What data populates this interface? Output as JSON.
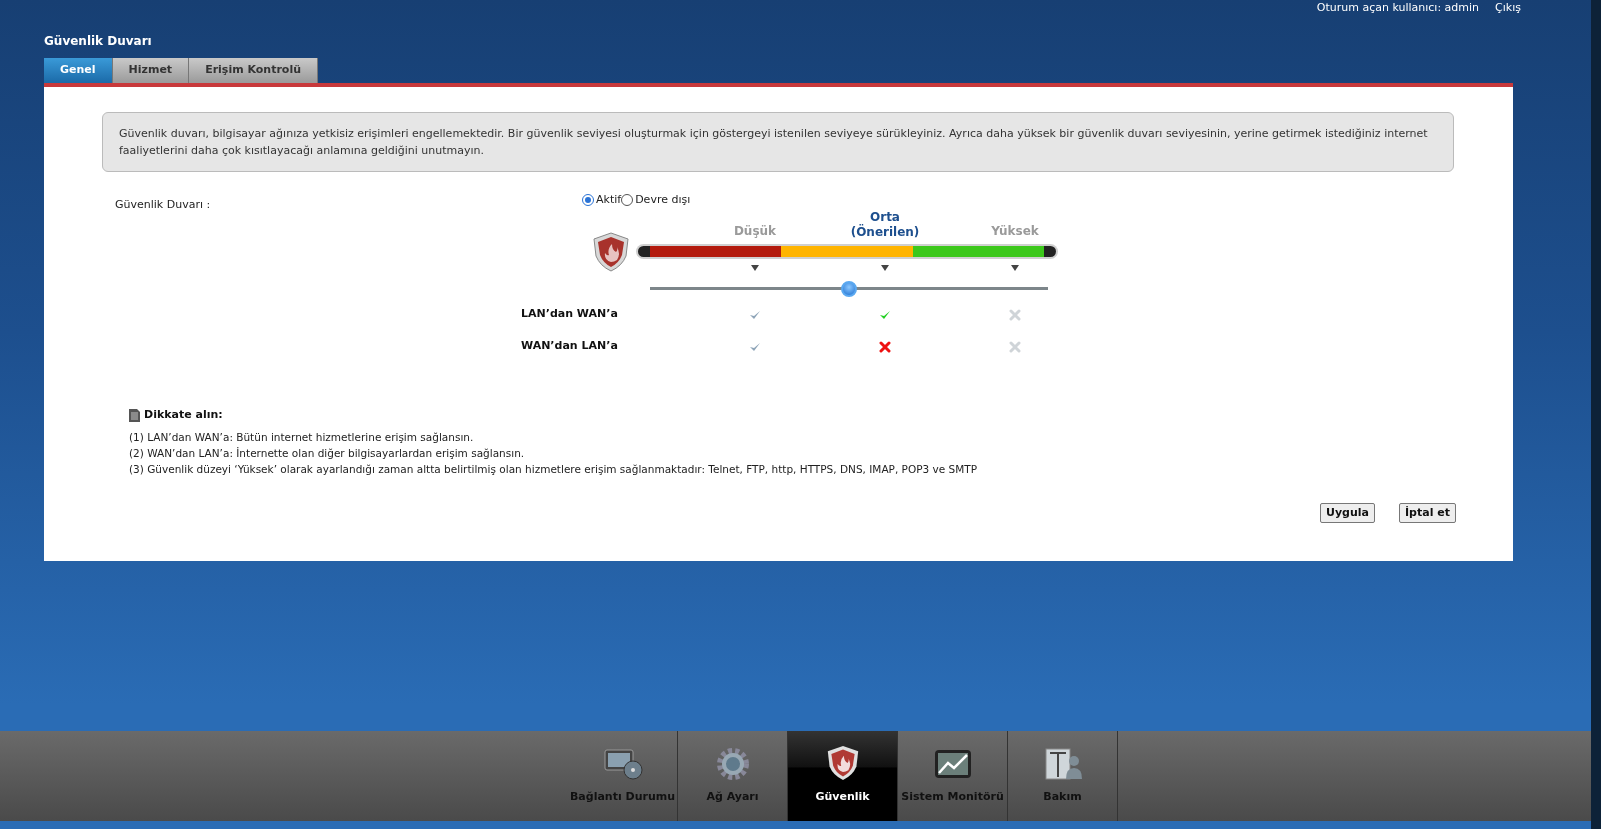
{
  "header": {
    "user_text": "Oturum açan kullanıcı: admin",
    "logout": "Çıkış"
  },
  "page_title": "Güvenlik Duvarı",
  "tabs": [
    {
      "label": "Genel",
      "selected": true
    },
    {
      "label": "Hizmet",
      "selected": false
    },
    {
      "label": "Erişim Kontrolü",
      "selected": false
    }
  ],
  "info": "Güvenlik duvarı, bilgisayar ağınıza yetkisiz erişimleri engellemektedir. Bir güvenlik seviyesi oluşturmak için göstergeyi istenilen seviyeye sürükleyiniz. Ayrıca daha yüksek bir güvenlik duvarı seviyesinin,  yerine getirmek istediğiniz internet faaliyetlerini daha çok kısıtlayacağı anlamına geldiğini unutmayın.",
  "firewall": {
    "label": "Güvenlik Duvarı :",
    "options": [
      {
        "label": "Aktif",
        "selected": true
      },
      {
        "label": "Devre dışı",
        "selected": false
      }
    ]
  },
  "levels": [
    {
      "label": "Düşük",
      "selected": false
    },
    {
      "label": "Orta\n(Önerilen)",
      "selected": true
    },
    {
      "label": "Yüksek",
      "selected": false
    }
  ],
  "slider": {
    "level": 0.5
  },
  "matrix": [
    {
      "label": "LAN’dan WAN’a",
      "cells": [
        {
          "kind": "check",
          "active": false
        },
        {
          "kind": "check",
          "active": true
        },
        {
          "kind": "cross",
          "active": false
        }
      ]
    },
    {
      "label": "WAN’dan LAN’a",
      "cells": [
        {
          "kind": "check",
          "active": false
        },
        {
          "kind": "cross",
          "active": true
        },
        {
          "kind": "cross",
          "active": false
        }
      ]
    }
  ],
  "notes": {
    "title": "Dikkate alın:",
    "items": [
      "(1) LAN’dan WAN’a: Bütün internet hizmetlerine erişim sağlansın.",
      "(2) WAN’dan LAN’a: İnternette olan diğer bilgisayarlardan erişim sağlansın.",
      "(3) Güvenlik düzeyi ‘Yüksek’ olarak ayarlandığı zaman altta belirtilmiş olan hizmetlere erişim sağlanmaktadır: Telnet, FTP, http, HTTPS, DNS, IMAP, POP3 ve SMTP"
    ]
  },
  "buttons": [
    "Uygula",
    "İptal et"
  ],
  "nav": [
    {
      "kind": "monitor",
      "label": "Bağlantı Durumu",
      "selected": false
    },
    {
      "kind": "gear",
      "label": "Ağ Ayarı",
      "selected": false
    },
    {
      "kind": "shield",
      "label": "Güvenlik",
      "selected": true
    },
    {
      "kind": "chart",
      "label": "Sistem Monitörü",
      "selected": false
    },
    {
      "kind": "maintenance",
      "label": "Bakım",
      "selected": false
    }
  ]
}
